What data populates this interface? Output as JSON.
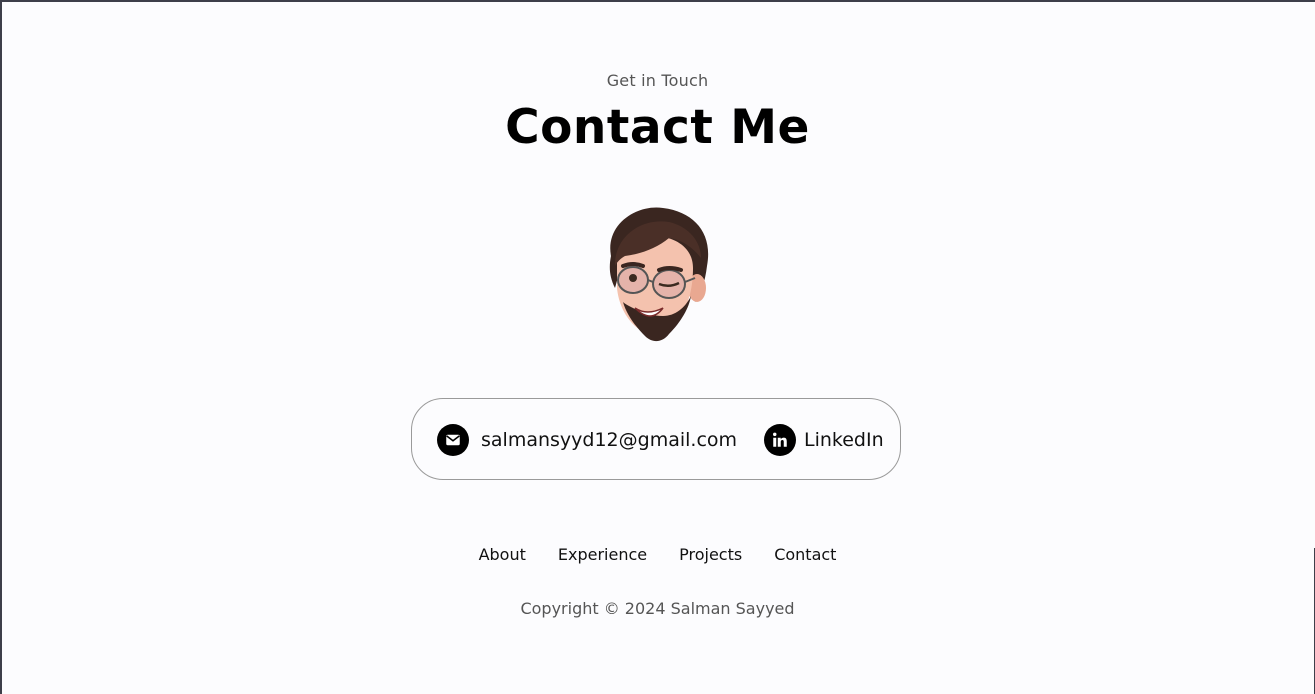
{
  "header": {
    "subtitle": "Get in Touch",
    "title": "Contact Me"
  },
  "avatar": {
    "icon": "memoji-avatar"
  },
  "contact": {
    "email": {
      "icon": "email-icon",
      "label": "salmansyyd12@gmail.com"
    },
    "linkedin": {
      "icon": "linkedin-icon",
      "label": "LinkedIn"
    }
  },
  "footer": {
    "nav": [
      "About",
      "Experience",
      "Projects",
      "Contact"
    ],
    "copyright": "Copyright © 2024 Salman Sayyed"
  },
  "colors": {
    "background": "#fcfcfe",
    "text": "#000000",
    "muted": "#555555",
    "border": "#9a9a9a"
  }
}
